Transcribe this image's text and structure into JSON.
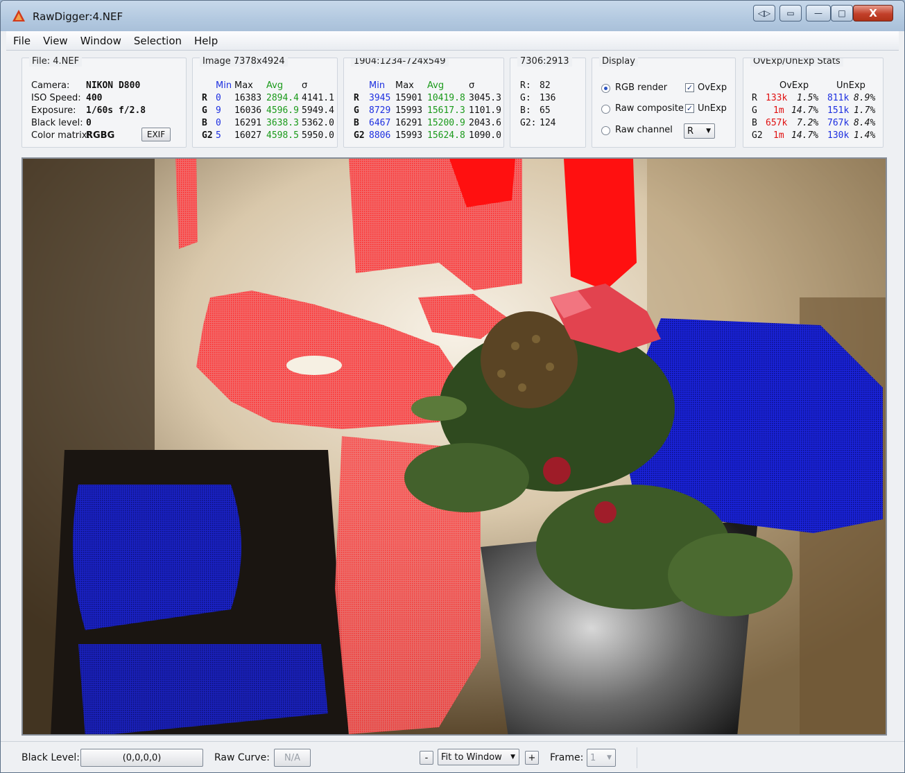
{
  "window": {
    "title": "RawDigger:4.NEF"
  },
  "menu": [
    "File",
    "View",
    "Window",
    "Selection",
    "Help"
  ],
  "file_panel": {
    "title": "File: 4.NEF",
    "rows": [
      {
        "label": "Camera:",
        "value": "NIKON D800"
      },
      {
        "label": "ISO Speed:",
        "value": "400"
      },
      {
        "label": "Exposure:",
        "value": "1/60s f/2.8"
      },
      {
        "label": "Black level:",
        "value": "0"
      },
      {
        "label": "Color matrix:",
        "value": "RGBG"
      }
    ],
    "exif_label": "EXIF"
  },
  "image_panel": {
    "title": "Image 7378x4924",
    "headers": [
      "Min",
      "Max",
      "Avg",
      "σ"
    ],
    "rows": [
      {
        "ch": "R",
        "min": "0",
        "max": "16383",
        "avg": "2894.4",
        "sigma": "4141.1"
      },
      {
        "ch": "G",
        "min": "9",
        "max": "16036",
        "avg": "4596.9",
        "sigma": "5949.4"
      },
      {
        "ch": "B",
        "min": "0",
        "max": "16291",
        "avg": "3638.3",
        "sigma": "5362.0"
      },
      {
        "ch": "G2",
        "min": "5",
        "max": "16027",
        "avg": "4598.5",
        "sigma": "5950.0"
      }
    ]
  },
  "selection_panel": {
    "title": "1904:1234-724x549",
    "headers": [
      "Min",
      "Max",
      "Avg",
      "σ"
    ],
    "rows": [
      {
        "ch": "R",
        "min": "3945",
        "max": "15901",
        "avg": "10419.8",
        "sigma": "3045.3"
      },
      {
        "ch": "G",
        "min": "8729",
        "max": "15993",
        "avg": "15617.3",
        "sigma": "1101.9"
      },
      {
        "ch": "B",
        "min": "6467",
        "max": "16291",
        "avg": "15200.9",
        "sigma": "2043.6"
      },
      {
        "ch": "G2",
        "min": "8806",
        "max": "15993",
        "avg": "15624.8",
        "sigma": "1090.0"
      }
    ]
  },
  "pixel_panel": {
    "title": "7306:2913",
    "rows": [
      {
        "label": "R:",
        "value": "82"
      },
      {
        "label": "G:",
        "value": "136"
      },
      {
        "label": "B:",
        "value": "65"
      },
      {
        "label": "G2:",
        "value": "124"
      }
    ]
  },
  "display_panel": {
    "title": "Display",
    "radios": [
      {
        "label": "RGB render",
        "selected": true
      },
      {
        "label": "Raw composite",
        "selected": false
      },
      {
        "label": "Raw channel",
        "selected": false
      }
    ],
    "checks": [
      {
        "label": "OvExp",
        "checked": true
      },
      {
        "label": "UnExp",
        "checked": true
      }
    ],
    "channel_select": "R"
  },
  "stats_panel": {
    "title": "OvExp/UnExp Stats",
    "headers": [
      "OvExp",
      "UnExp"
    ],
    "rows": [
      {
        "ch": "R",
        "ov": "133k",
        "ov_pct": "1.5%",
        "un": "811k",
        "un_pct": "8.9%"
      },
      {
        "ch": "G",
        "ov": "1m",
        "ov_pct": "14.7%",
        "un": "151k",
        "un_pct": "1.7%"
      },
      {
        "ch": "B",
        "ov": "657k",
        "ov_pct": "7.2%",
        "un": "767k",
        "un_pct": "8.4%"
      },
      {
        "ch": "G2",
        "ov": "1m",
        "ov_pct": "14.7%",
        "un": "130k",
        "un_pct": "1.4%"
      }
    ]
  },
  "bottom": {
    "black_level_label": "Black Level:",
    "black_level_value": "(0,0,0,0)",
    "raw_curve_label": "Raw Curve:",
    "raw_curve_value": "N/A",
    "minus": "-",
    "zoom": "Fit to Window",
    "plus": "+",
    "frame_label": "Frame:",
    "frame_value": "1"
  },
  "colors": {
    "overexposure": "#ff2a2a",
    "underexposure": "#1a23d9",
    "min_col": "#1d2fe0",
    "avg_col": "#1a9a1a"
  }
}
